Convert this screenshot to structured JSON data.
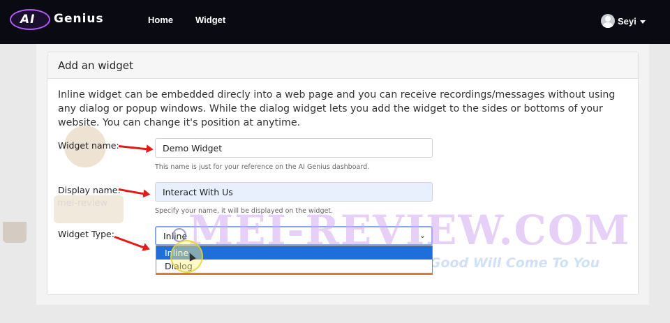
{
  "navbar": {
    "logo_ai": "AI",
    "logo_text": "Genius",
    "links": [
      "Home",
      "Widget"
    ],
    "user_name": "Seyi"
  },
  "card": {
    "title": "Add an widget",
    "intro": "Inline widget can be embedded direcly into a web page and you can receive recordings/messages without using any dialog or popup windows. While the dialog widget lets you add the widget to the sides or bottoms of your website. You can change it's position at anytime."
  },
  "form": {
    "widget_name_label": "Widget name:",
    "widget_name_value": "Demo Widget",
    "widget_name_help": "This name is just for your reference on the AI Genius dashboard.",
    "display_name_label": "Display name:",
    "display_name_value": "Interact With Us",
    "display_name_help": "Specify your name, it will be displayed on the widget.",
    "widget_type_label": "Widget Type:",
    "widget_type_selected": "Inline",
    "widget_type_options": [
      "Inline",
      "Dialog"
    ]
  },
  "watermark": {
    "main": "MEI-REVIEW.COM",
    "tagline": "Do Good And Good Will Come To You",
    "mascot_label": "mei-review"
  },
  "colors": {
    "navbar_bg": "#0a0b12",
    "selected_option": "#1e6fd9",
    "arrow": "#e41b1b",
    "autofill_bg": "#e8f0fe"
  }
}
